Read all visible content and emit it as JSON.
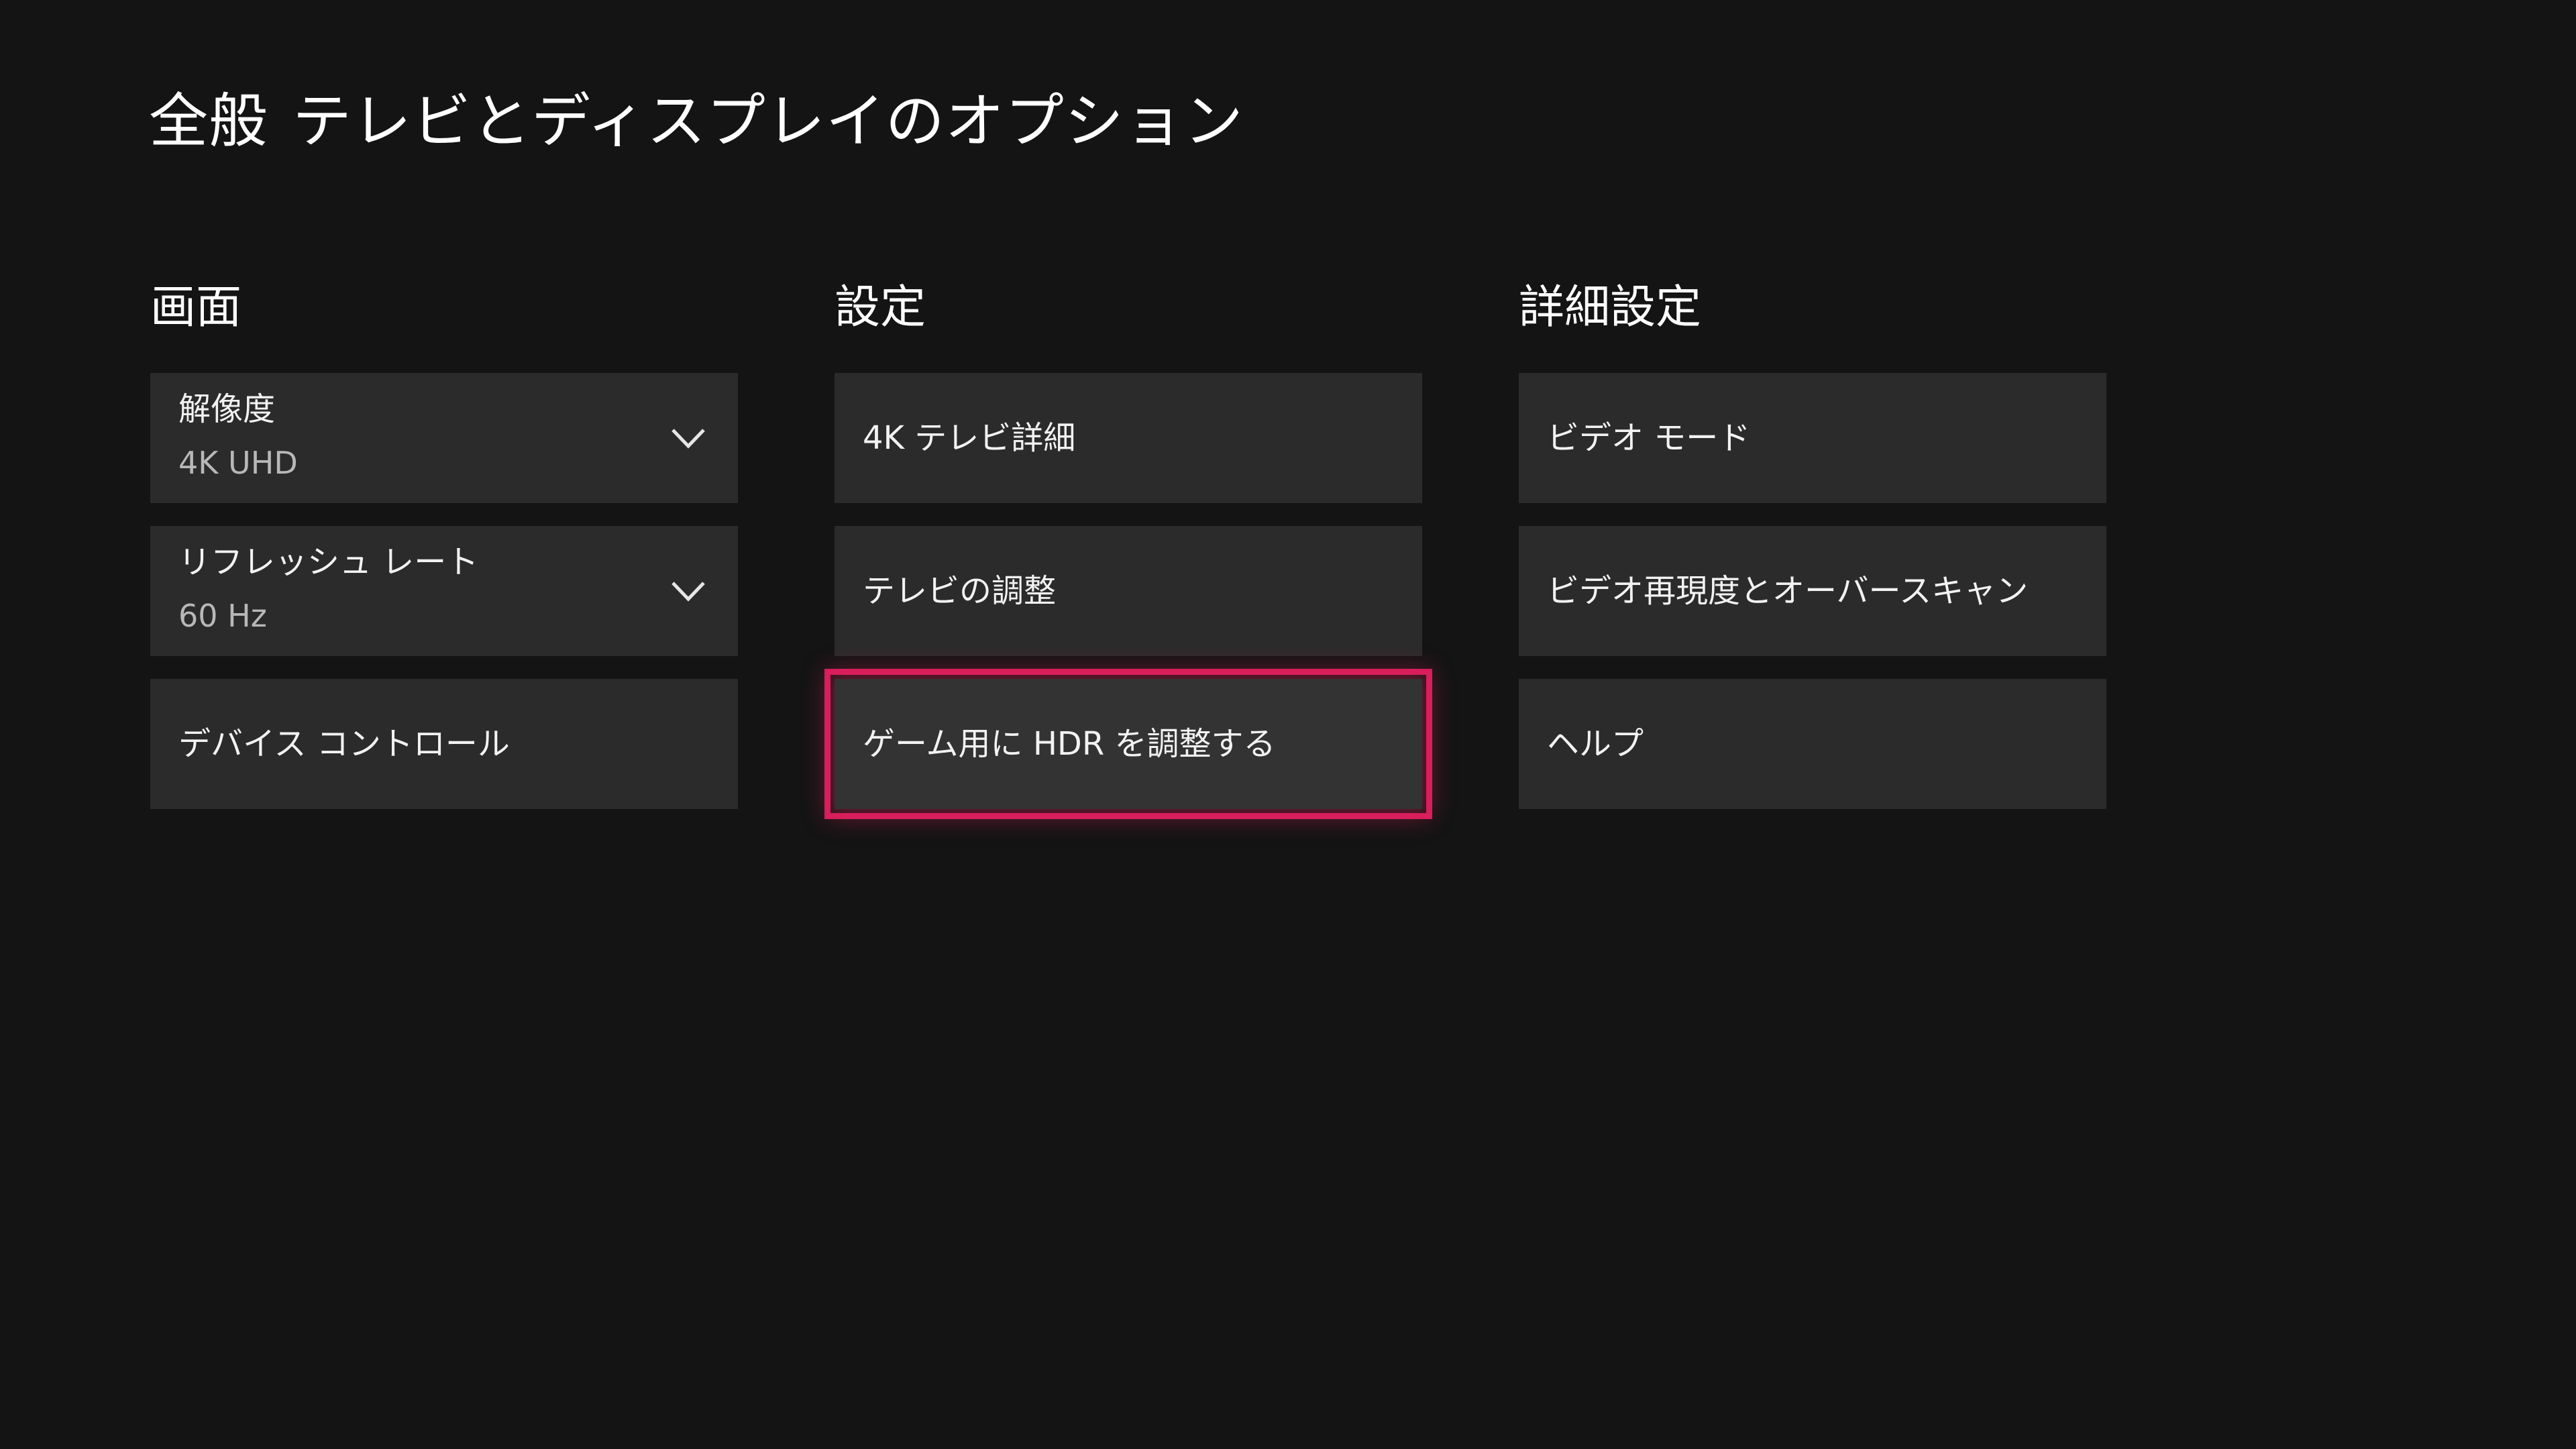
{
  "header": {
    "section": "全般",
    "title": "テレビとディスプレイのオプション"
  },
  "columns": [
    {
      "title": "画面",
      "items": [
        {
          "label": "解像度",
          "value": "4K UHD",
          "icon": "chevron-down-icon"
        },
        {
          "label": "リフレッシュ レート",
          "value": "60 Hz",
          "icon": "chevron-down-icon"
        },
        {
          "label": "デバイス コントロール"
        }
      ]
    },
    {
      "title": "設定",
      "items": [
        {
          "label": "4K テレビ詳細"
        },
        {
          "label": "テレビの調整"
        },
        {
          "label": "ゲーム用に HDR を調整する",
          "focused": true
        }
      ]
    },
    {
      "title": "詳細設定",
      "items": [
        {
          "label": "ビデオ モード"
        },
        {
          "label": "ビデオ再現度とオーバースキャン"
        },
        {
          "label": "ヘルプ"
        }
      ]
    }
  ],
  "colors": {
    "background": "#141414",
    "tile": "#2b2b2b",
    "focus": "#d81e5b"
  }
}
